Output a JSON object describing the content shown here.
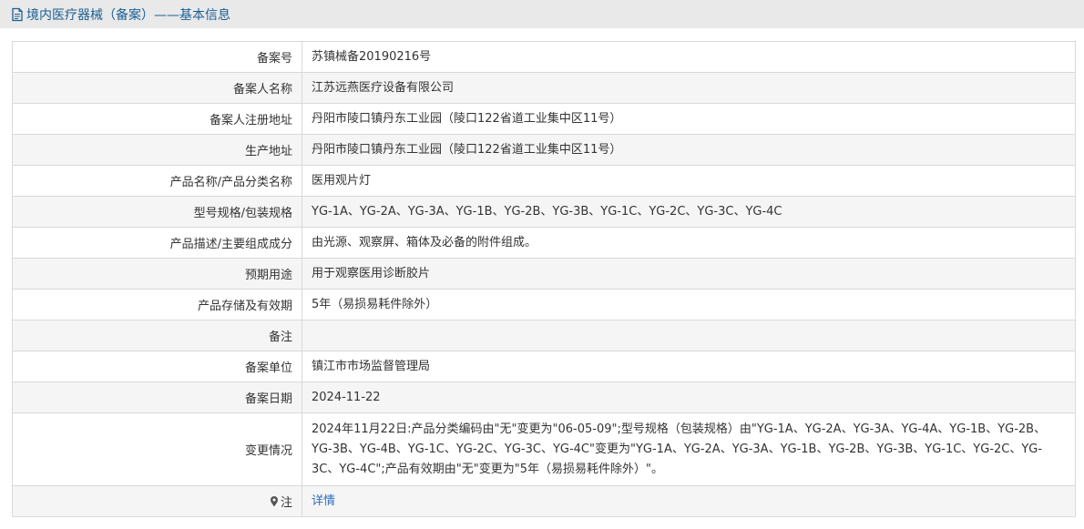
{
  "header": {
    "title": "境内医疗器械（备案）——基本信息",
    "icon": "document-icon",
    "title_color": "#1a5f94"
  },
  "rows": [
    {
      "label": "备案号",
      "value": "苏镇械备20190216号"
    },
    {
      "label": "备案人名称",
      "value": "江苏远燕医疗设备有限公司"
    },
    {
      "label": "备案人注册地址",
      "value": "丹阳市陵口镇丹东工业园（陵口122省道工业集中区11号）"
    },
    {
      "label": "生产地址",
      "value": "丹阳市陵口镇丹东工业园（陵口122省道工业集中区11号）"
    },
    {
      "label": "产品名称/产品分类名称",
      "value": "医用观片灯"
    },
    {
      "label": "型号规格/包装规格",
      "value": "YG-1A、YG-2A、YG-3A、YG-1B、YG-2B、YG-3B、YG-1C、YG-2C、YG-3C、YG-4C"
    },
    {
      "label": "产品描述/主要组成成分",
      "value": "由光源、观察屏、箱体及必备的附件组成。"
    },
    {
      "label": "预期用途",
      "value": "用于观察医用诊断胶片"
    },
    {
      "label": "产品存储及有效期",
      "value": "5年（易损易耗件除外）"
    },
    {
      "label": "备注",
      "value": ""
    },
    {
      "label": "备案单位",
      "value": "镇江市市场监督管理局"
    },
    {
      "label": "备案日期",
      "value": "2024-11-22"
    },
    {
      "label": "变更情况",
      "value": "2024年11月22日:产品分类编码由\"无\"变更为\"06-05-09\";型号规格（包装规格）由\"YG-1A、YG-2A、YG-3A、YG-4A、YG-1B、YG-2B、YG-3B、YG-4B、YG-1C、YG-2C、YG-3C、YG-4C\"变更为\"YG-1A、YG-2A、YG-3A、YG-1B、YG-2B、YG-3B、YG-1C、YG-2C、YG-3C、YG-4C\";产品有效期由\"无\"变更为\"5年（易损易耗件除外）\"。"
    }
  ],
  "note": {
    "label": "注",
    "icon": "pin-icon",
    "link_text": "详情",
    "link_color": "#2a6dbd"
  }
}
